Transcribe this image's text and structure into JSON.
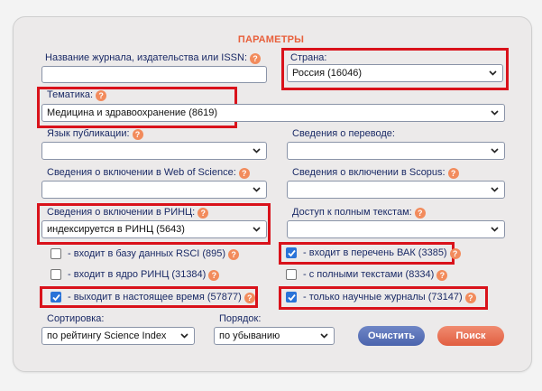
{
  "panel": {
    "title": "ПАРАМЕТРЫ"
  },
  "fields": {
    "journal_label": "Название журнала, издательства или ISSN:",
    "journal_value": "",
    "country_label": "Страна:",
    "country_value": "Россия  (16046)",
    "topic_label": "Тематика:",
    "topic_value": "Медицина и здравоохранение  (8619)",
    "language_label": "Язык публикации:",
    "language_value": "",
    "translation_label": "Сведения о переводе:",
    "translation_value": "",
    "wos_label": "Сведения о включении в Web of Science:",
    "wos_value": "",
    "scopus_label": "Сведения о включении в Scopus:",
    "scopus_value": "",
    "rinc_label": "Сведения о включении в РИНЦ:",
    "rinc_value": "индексируется в РИНЦ  (5643)",
    "fulltext_label": "Доступ к полным текстам:",
    "fulltext_value": ""
  },
  "checkboxes": [
    {
      "label": "- входит в базу данных RSCI (895)",
      "checked": false
    },
    {
      "label": "- входит в перечень ВАК (3385)",
      "checked": true
    },
    {
      "label": "- входит в ядро РИНЦ (31384)",
      "checked": false
    },
    {
      "label": "- с полными текстами (8334)",
      "checked": false
    },
    {
      "label": "- выходит в настоящее время (57877)",
      "checked": true
    },
    {
      "label": "- только научные журналы (73147)",
      "checked": true
    }
  ],
  "sorting": {
    "label": "Сортировка:",
    "value": "по рейтингу Science Index"
  },
  "order": {
    "label": "Порядок:",
    "value": "по убыванию"
  },
  "buttons": {
    "clear": "Очистить",
    "search": "Поиск"
  },
  "help_glyph": "?",
  "icons": {
    "help": "help-icon",
    "dropdown": "chevron-down-icon",
    "check": "check-icon"
  },
  "colors": {
    "title": "#e8603c",
    "highlight": "#d9121b",
    "clear_button": "#5a72b8",
    "search_button": "#e8694c",
    "checkbox": "#2a73d8"
  }
}
